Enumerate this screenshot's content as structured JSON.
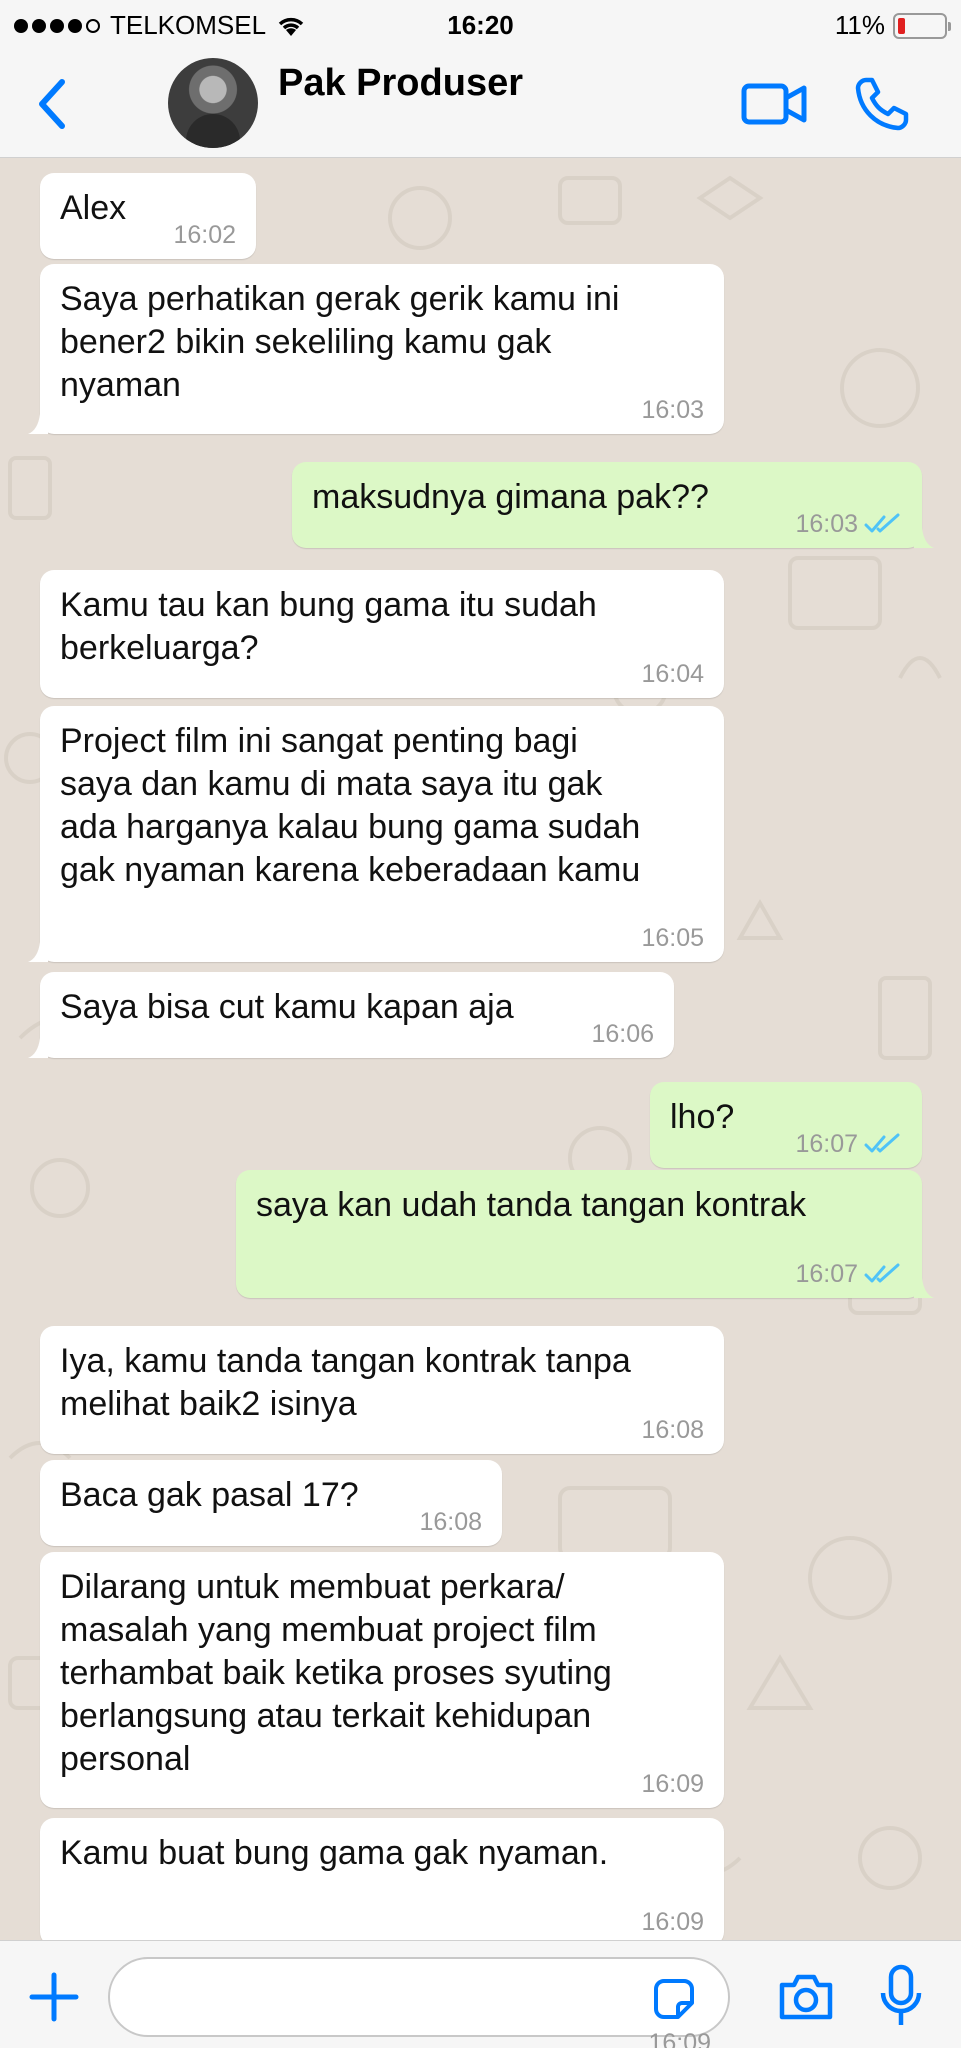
{
  "status_bar": {
    "carrier": "TELKOMSEL",
    "time": "16:20",
    "battery": "11%",
    "battery_level": 0.11
  },
  "header": {
    "contact_name": "Pak Produser",
    "icons": [
      "back-chevron-icon",
      "video-call-icon",
      "phone-call-icon"
    ]
  },
  "messages": [
    {
      "dir": "in",
      "text": "Alex",
      "time": "16:02"
    },
    {
      "dir": "in",
      "text": "Saya perhatikan gerak gerik kamu ini\nbener2 bikin sekeliling kamu gak\nnyaman",
      "time": "16:03"
    },
    {
      "dir": "out",
      "text": "maksudnya gimana pak??",
      "time": "16:03",
      "status": "read"
    },
    {
      "dir": "in",
      "text": "Kamu tau kan bung gama itu sudah\nberkeluarga?",
      "time": "16:04"
    },
    {
      "dir": "in",
      "text": "Project film ini sangat penting bagi\nsaya dan kamu di mata saya itu gak\nada harganya kalau bung gama sudah\ngak nyaman karena keberadaan kamu",
      "time": "16:05"
    },
    {
      "dir": "in",
      "text": "Saya bisa cut kamu kapan aja",
      "time": "16:06"
    },
    {
      "dir": "out",
      "text": "lho?",
      "time": "16:07",
      "status": "read"
    },
    {
      "dir": "out",
      "text": "saya kan udah tanda tangan kontrak",
      "time": "16:07",
      "status": "read"
    },
    {
      "dir": "in",
      "text": "Iya, kamu tanda tangan kontrak tanpa\nmelihat baik2 isinya",
      "time": "16:08"
    },
    {
      "dir": "in",
      "text": "Baca gak pasal 17?",
      "time": "16:08"
    },
    {
      "dir": "in",
      "text": "Dilarang untuk membuat perkara/\nmasalah yang membuat project film\nterhambat baik ketika proses syuting\nberlangsung atau terkait kehidupan\npersonal",
      "time": "16:09"
    },
    {
      "dir": "in",
      "text": "Kamu buat bung gama gak nyaman.",
      "time": "16:09"
    }
  ],
  "input_bar": {
    "placeholder": "",
    "peek_time": "16:09",
    "icons": [
      "plus-icon",
      "sticker-icon",
      "camera-icon",
      "microphone-icon"
    ]
  },
  "colors": {
    "accent": "#007aff",
    "outgoing_bubble": "#dcf8c6",
    "incoming_bubble": "#ffffff",
    "chat_background": "#e5ddd5",
    "read_ticks": "#4fc3f7"
  }
}
